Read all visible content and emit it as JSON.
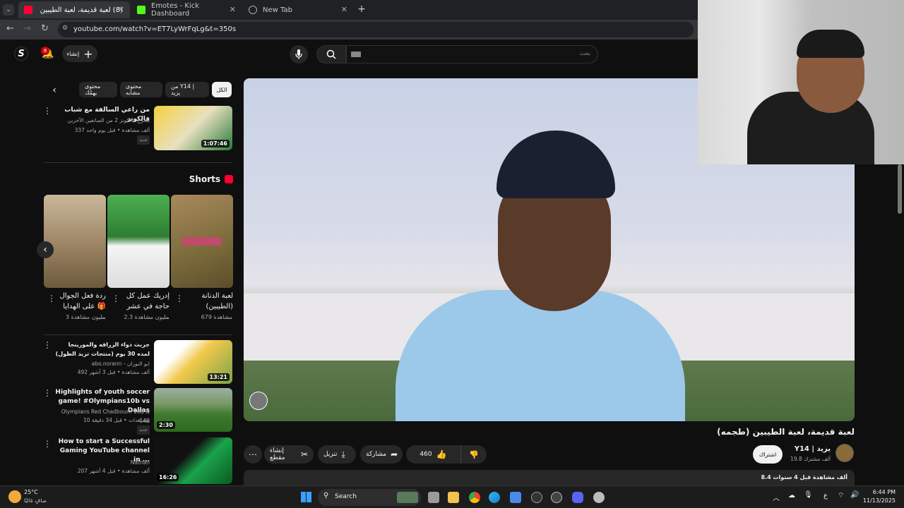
{
  "browser": {
    "tabs": [
      {
        "label": "(8) لعبة قديمة، لعبة الطيبين (طجمه"
      },
      {
        "label": "Emotes - Kick Dashboard"
      },
      {
        "label": "New Tab"
      }
    ],
    "url": "youtube.com/watch?v=ET7LyWrFqLg&t=350s",
    "new_tab": "+"
  },
  "header": {
    "logo": "S",
    "notifications": "8",
    "create_label": "إنشاء",
    "search_placeholder": "بحث"
  },
  "chips": [
    "الكل",
    "من Y14 | يزيد",
    "محتوى مشابه",
    "محتوى يهمّك"
  ],
  "recommended": [
    {
      "title": "من راعي السالفة مع شباب فالكونز",
      "channel": "مخرج فالكونز 2 من الصانعين الآخرين",
      "meta": "337 ألف مشاهدة • قبل يوم واحد",
      "badge": "جديد",
      "duration": "1:07:46"
    }
  ],
  "shorts": {
    "heading": "Shorts",
    "items": [
      {
        "title": "لعبة الدنانة (الطيبين)",
        "views": "679 مشاهدة"
      },
      {
        "title": "إدريك عمل كل حاجة في عشر ...",
        "views": "2.3 مليون مشاهدة"
      },
      {
        "title": "ردة فعل الجوال على الهدايا 🎁 ...",
        "views": "3 مليون مشاهدة"
      }
    ]
  },
  "more_videos": [
    {
      "title": "جربت دواء الزرافه والمورينجا لمده 30 يوم (منتجات تزيد الطول)",
      "channel": "abo.norann - ابو النوران",
      "meta": "492 ألف مشاهدة • قبل 3 أشهر",
      "duration": "13:21"
    },
    {
      "title": "Highlights of youth soccer game! #Olympians10b vs Dallas",
      "channel": "Olympians Red Chadbourn 10B & 14B",
      "meta": "10 مشاهدات • قبل 34 دقيقة",
      "badge": "جديد",
      "duration": "2:30"
    },
    {
      "title": "How to start a Successful Gaming YouTube channel in ...",
      "channel": "Nathan",
      "meta": "207 ألف مشاهدة • قبل 4 أشهر",
      "duration": "16:26"
    }
  ],
  "video": {
    "title": "لعبة قديمة، لعبة الطيبين (طجمه)",
    "channel": "Y14 | يزيد",
    "subscribers": "19.8 ألف مشترك",
    "subscribe_label": "اشتراك",
    "likes": "460",
    "share_label": "مشاركة",
    "download_label": "تنزيل",
    "clip_label": "إنشاء مقطع",
    "description_meta": "8.4 ألف مشاهدة  قبل 4 سنوات"
  },
  "taskbar": {
    "weather_temp": "25°C",
    "weather_desc": "صافٍ غالبًا",
    "search_label": "Search",
    "time": "6:44 PM",
    "date": "11/13/2025",
    "lang": "ع"
  },
  "colors": {
    "accent": "#ff0033",
    "kick": "#53fc18",
    "bg": "#0f0f0f"
  }
}
